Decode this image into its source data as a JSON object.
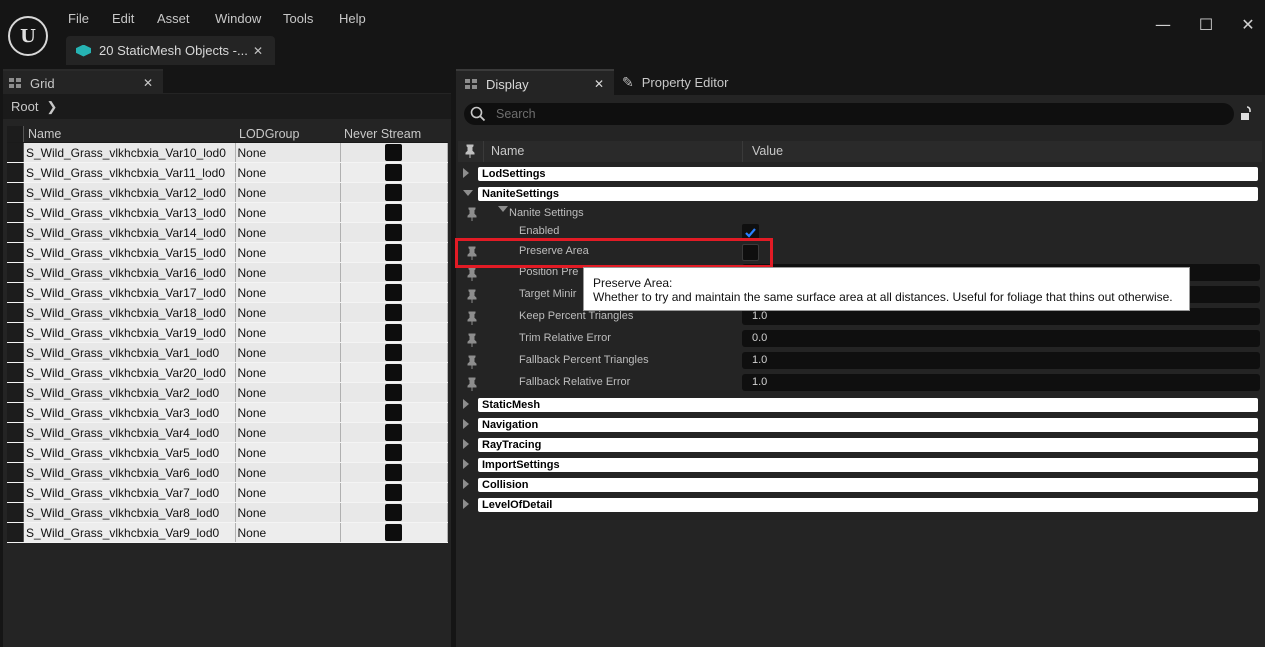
{
  "menu": [
    "File",
    "Edit",
    "Asset",
    "Window",
    "Tools",
    "Help"
  ],
  "document_tab": {
    "label": "20 StaticMesh Objects -...",
    "close": "✕"
  },
  "window_controls": {
    "minimize": "—",
    "maximize": "☐",
    "close": "✕"
  },
  "grid_panel": {
    "tab_label": "Grid",
    "breadcrumb": "Root",
    "columns": [
      "Name",
      "LODGroup",
      "Never Stream"
    ],
    "rows": [
      {
        "name": "S_Wild_Grass_vlkhcbxia_Var10_lod0",
        "lod": "None"
      },
      {
        "name": "S_Wild_Grass_vlkhcbxia_Var11_lod0",
        "lod": "None"
      },
      {
        "name": "S_Wild_Grass_vlkhcbxia_Var12_lod0",
        "lod": "None"
      },
      {
        "name": "S_Wild_Grass_vlkhcbxia_Var13_lod0",
        "lod": "None"
      },
      {
        "name": "S_Wild_Grass_vlkhcbxia_Var14_lod0",
        "lod": "None"
      },
      {
        "name": "S_Wild_Grass_vlkhcbxia_Var15_lod0",
        "lod": "None"
      },
      {
        "name": "S_Wild_Grass_vlkhcbxia_Var16_lod0",
        "lod": "None"
      },
      {
        "name": "S_Wild_Grass_vlkhcbxia_Var17_lod0",
        "lod": "None"
      },
      {
        "name": "S_Wild_Grass_vlkhcbxia_Var18_lod0",
        "lod": "None"
      },
      {
        "name": "S_Wild_Grass_vlkhcbxia_Var19_lod0",
        "lod": "None"
      },
      {
        "name": "S_Wild_Grass_vlkhcbxia_Var1_lod0",
        "lod": "None"
      },
      {
        "name": "S_Wild_Grass_vlkhcbxia_Var20_lod0",
        "lod": "None"
      },
      {
        "name": "S_Wild_Grass_vlkhcbxia_Var2_lod0",
        "lod": "None"
      },
      {
        "name": "S_Wild_Grass_vlkhcbxia_Var3_lod0",
        "lod": "None"
      },
      {
        "name": "S_Wild_Grass_vlkhcbxia_Var4_lod0",
        "lod": "None"
      },
      {
        "name": "S_Wild_Grass_vlkhcbxia_Var5_lod0",
        "lod": "None"
      },
      {
        "name": "S_Wild_Grass_vlkhcbxia_Var6_lod0",
        "lod": "None"
      },
      {
        "name": "S_Wild_Grass_vlkhcbxia_Var7_lod0",
        "lod": "None"
      },
      {
        "name": "S_Wild_Grass_vlkhcbxia_Var8_lod0",
        "lod": "None"
      },
      {
        "name": "S_Wild_Grass_vlkhcbxia_Var9_lod0",
        "lod": "None"
      }
    ]
  },
  "display_panel": {
    "tab_label": "Display",
    "property_editor_label": "Property Editor",
    "search_placeholder": "Search",
    "header": {
      "name": "Name",
      "value": "Value"
    },
    "categories_top": [
      "LodSettings",
      "NaniteSettings"
    ],
    "nanite_group": "Nanite Settings",
    "properties": {
      "enabled": "Enabled",
      "preserve_area": "Preserve Area",
      "position_precision": "Position Pre",
      "target_minimum": "Target Minir",
      "keep_percent": "Keep Percent Triangles",
      "keep_percent_value": "1.0",
      "trim_error": "Trim Relative Error",
      "trim_error_value": "0.0",
      "fallback_percent": "Fallback Percent Triangles",
      "fallback_percent_value": "1.0",
      "fallback_error": "Fallback Relative Error",
      "fallback_error_value": "1.0"
    },
    "enabled_checked": true,
    "preserve_area_checked": false,
    "categories_bottom": [
      "StaticMesh",
      "Navigation",
      "RayTracing",
      "ImportSettings",
      "Collision",
      "LevelOfDetail"
    ]
  },
  "tooltip": {
    "title": "Preserve Area:",
    "body": "Whether to try and maintain the same surface area at all distances. Useful for foliage that thins out otherwise."
  },
  "colors": {
    "highlight": "#e21b25",
    "accent_check": "#2a7fff",
    "asset_icon": "#26b3b3"
  }
}
